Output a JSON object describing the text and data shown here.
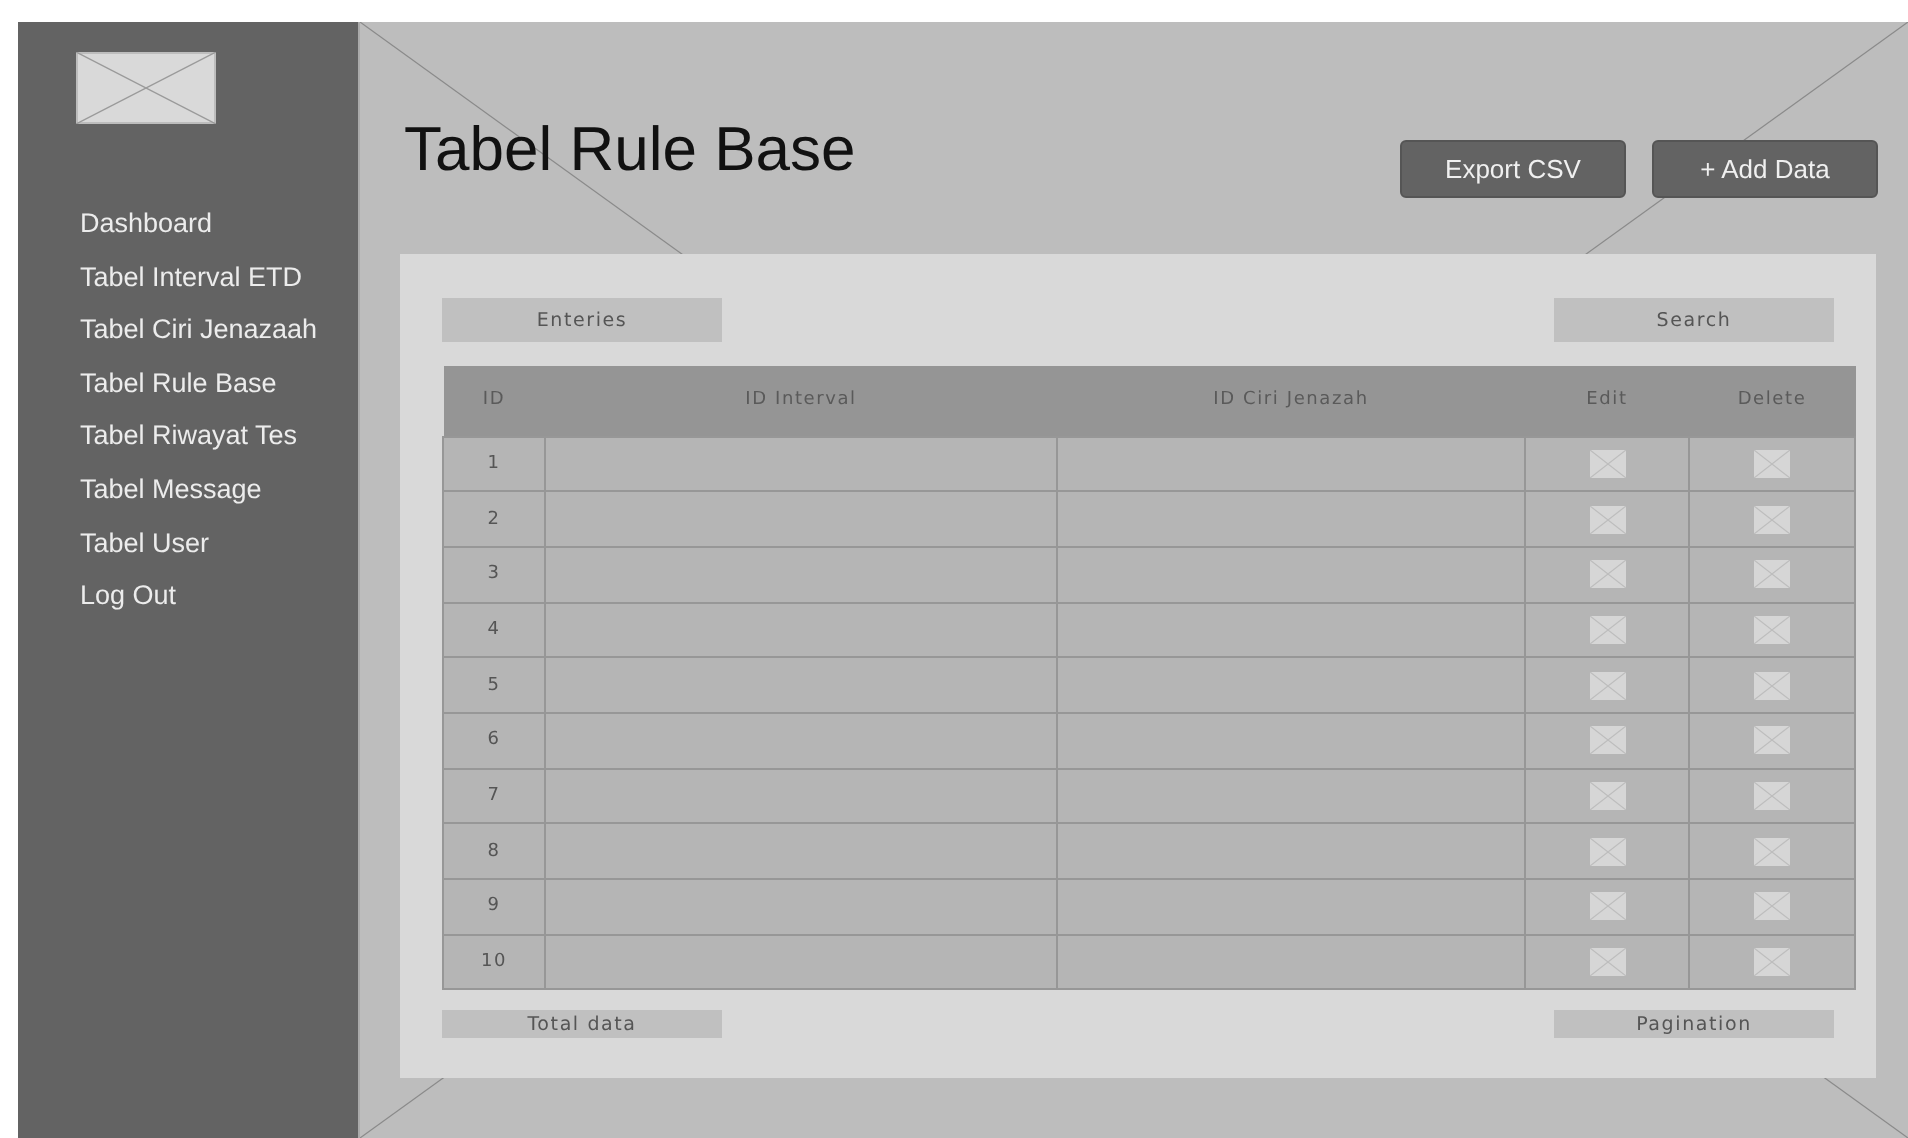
{
  "sidebar": {
    "items": [
      {
        "label": "Dashboard"
      },
      {
        "label": "Tabel Interval ETD"
      },
      {
        "label": "Tabel Ciri Jenazaah"
      },
      {
        "label": "Tabel Rule Base"
      },
      {
        "label": "Tabel Riwayat Tes"
      },
      {
        "label": "Tabel Message"
      },
      {
        "label": "Tabel User"
      },
      {
        "label": "Log Out"
      }
    ]
  },
  "page_title": "Tabel Rule Base",
  "buttons": [
    "Export CSV",
    "+ Add Data"
  ],
  "entries": "Enteries",
  "search": "Search",
  "table": {
    "columns": [
      "ID",
      "ID Interval",
      "ID Ciri Jenazah",
      "Edit",
      "Delete"
    ],
    "rows": [
      {
        "id": "1"
      },
      {
        "id": "2"
      },
      {
        "id": "3"
      },
      {
        "id": "4"
      },
      {
        "id": "5"
      },
      {
        "id": "6"
      },
      {
        "id": "7"
      },
      {
        "id": "8"
      },
      {
        "id": "9"
      },
      {
        "id": "10"
      }
    ]
  },
  "total_data": "Total data",
  "pagination": "Pagination"
}
